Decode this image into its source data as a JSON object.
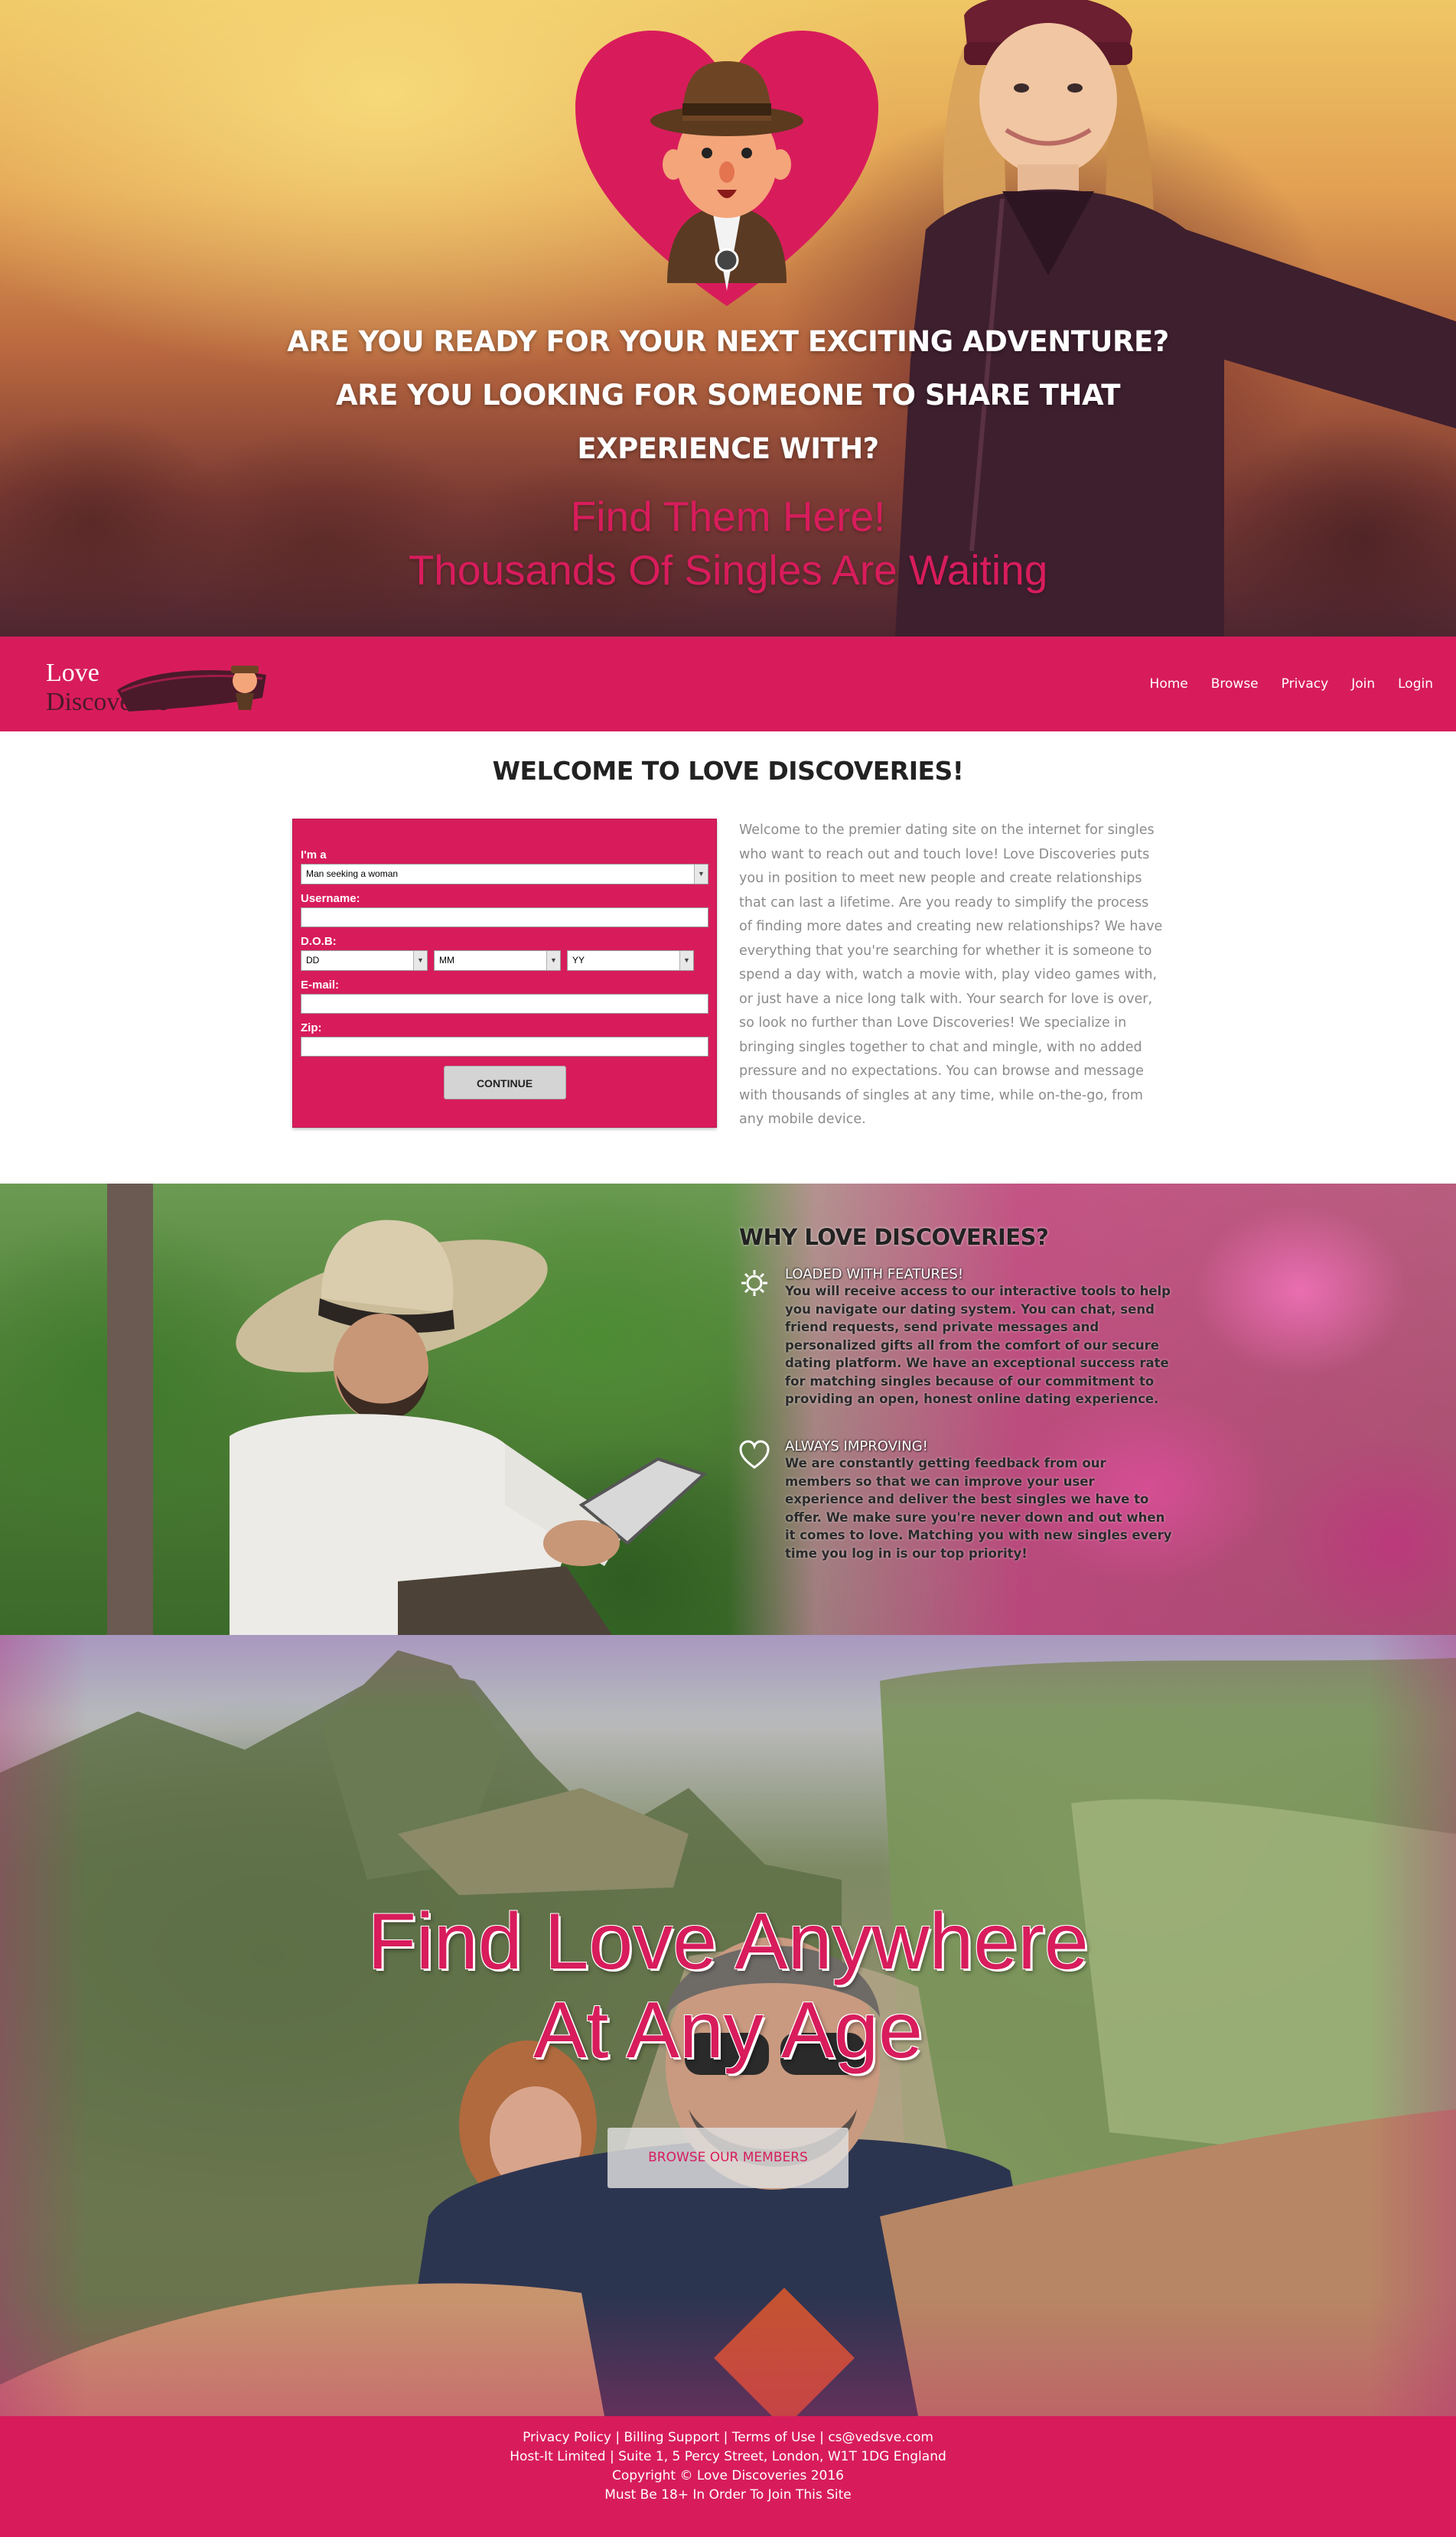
{
  "hero": {
    "questions": [
      "ARE YOU READY FOR YOUR NEXT EXCITING ADVENTURE?",
      "ARE YOU LOOKING FOR SOMEONE TO SHARE THAT",
      "EXPERIENCE WITH?"
    ],
    "find_lines": [
      "Find Them Here!",
      "Thousands Of Singles Are Waiting"
    ]
  },
  "nav": {
    "logo_line1": "Love",
    "logo_line2": "Discoveries",
    "links": [
      "Home",
      "Browse",
      "Privacy",
      "Join",
      "Login"
    ]
  },
  "welcome": {
    "title": "WELCOME TO LOVE DISCOVERIES!",
    "text": "Welcome to the premier dating site on the internet for singles who want to reach out and touch love! Love Discoveries puts you in position to meet new people and create relationships that can last a lifetime. Are you ready to simplify the process of finding more dates and creating new relationships? We have everything that you're searching for whether it is someone to spend a day with, watch a movie with, play video games with, or just have a nice long talk with. Your search for love is over, so look no further than Love Discoveries! We specialize in bringing singles together to chat and mingle, with no added pressure and no expectations. You can browse and message with thousands of singles at any time, while on-the-go, from any mobile device."
  },
  "form": {
    "ima_label": "I'm a",
    "ima_value": "Man seeking a woman",
    "username_label": "Username:",
    "username_value": "",
    "dob_label": "D.O.B:",
    "dd": "DD",
    "mm": "MM",
    "yy": "YY",
    "email_label": "E-mail:",
    "email_value": "",
    "zip_label": "Zip:",
    "zip_value": "",
    "continue_label": "CONTINUE"
  },
  "why": {
    "title": "WHY LOVE DISCOVERIES?",
    "features": [
      {
        "icon": "gear-icon",
        "heading": "LOADED WITH FEATURES!",
        "text": "You will receive access to our interactive tools to help you navigate our dating system. You can chat, send friend requests, send private messages and personalized gifts all from the comfort of our secure dating platform. We have an exceptional success rate for matching singles because of our commitment to providing an open, honest online dating experience."
      },
      {
        "icon": "heart-icon",
        "heading": "ALWAYS IMPROVING!",
        "text": "We are constantly getting feedback from our members so that we can improve your user experience and deliver the best singles we have to offer. We make sure you're never down and out when it comes to love. Matching you with new singles every time you log in is our top priority!"
      }
    ]
  },
  "selfie": {
    "title_line1": "Find Love Anywhere",
    "title_line2": "At Any Age",
    "browse_label": "BROWSE OUR MEMBERS"
  },
  "footer": {
    "privacy": "Privacy Policy",
    "billing": "Billing Support",
    "terms": "Terms of Use",
    "email": "cs@vedsve.com",
    "address": "Host-It Limited | Suite 1, 5 Percy Street, London, W1T 1DG England",
    "copyright": "Copyright © Love Discoveries 2016",
    "age_notice": "Must Be 18+ In Order To Join This Site"
  },
  "colors": {
    "brand_pink": "#d81c5b",
    "heading_dark": "#222222",
    "body_grey": "#8b8b8b"
  }
}
